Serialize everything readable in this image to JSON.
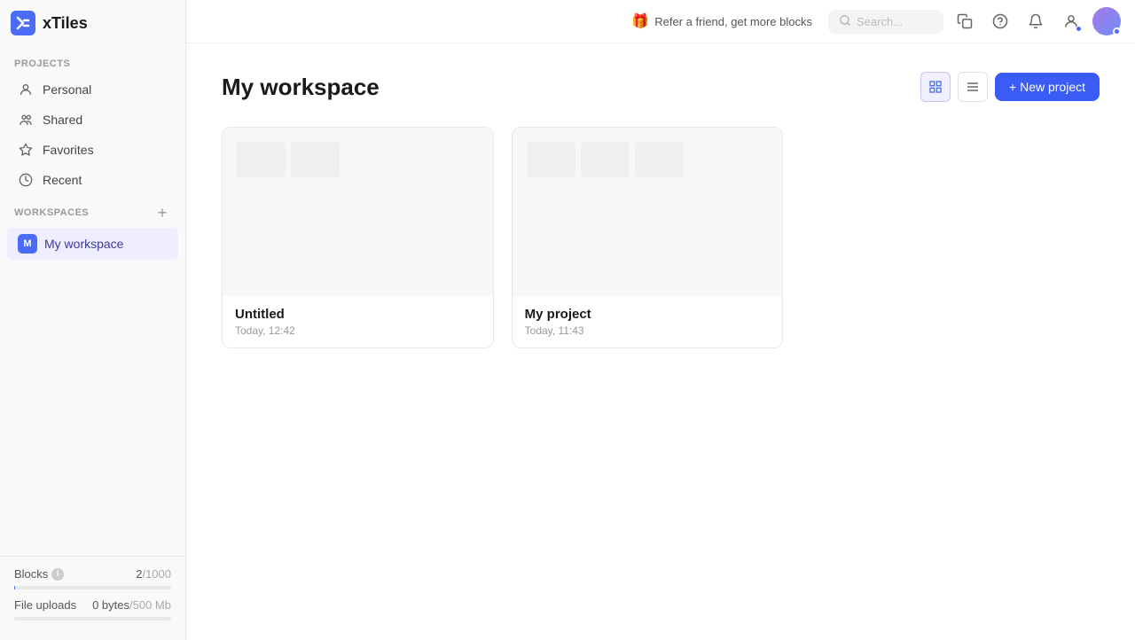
{
  "app": {
    "name": "xTiles",
    "logo_letter": "x"
  },
  "topbar": {
    "referral_text": "Refer a friend, get more blocks",
    "search_placeholder": "Search...",
    "icons": [
      "copy-icon",
      "help-circle-icon",
      "bell-icon",
      "user-circle-icon"
    ]
  },
  "sidebar": {
    "projects_label": "PROJECTS",
    "workspaces_label": "WORKSPACES",
    "nav_items": [
      {
        "id": "personal",
        "label": "Personal",
        "icon": "person-circle"
      },
      {
        "id": "shared",
        "label": "Shared",
        "icon": "people"
      },
      {
        "id": "favorites",
        "label": "Favorites",
        "icon": "star"
      },
      {
        "id": "recent",
        "label": "Recent",
        "icon": "clock"
      }
    ],
    "workspace_items": [
      {
        "id": "my-workspace",
        "label": "My workspace",
        "letter": "M"
      }
    ],
    "bottom": {
      "blocks_label": "Blocks",
      "blocks_current": "2",
      "blocks_max": "/1000",
      "blocks_progress": 0.2,
      "file_uploads_label": "File uploads",
      "file_uploads_current": "0 bytes",
      "file_uploads_max": "/500 Mb",
      "file_uploads_progress": 0
    }
  },
  "main": {
    "page_title": "My workspace",
    "new_project_label": "+ New project",
    "projects": [
      {
        "id": "untitled",
        "name": "Untitled",
        "date": "Today, 12:42"
      },
      {
        "id": "my-project",
        "name": "My project",
        "date": "Today, 11:43"
      }
    ]
  }
}
